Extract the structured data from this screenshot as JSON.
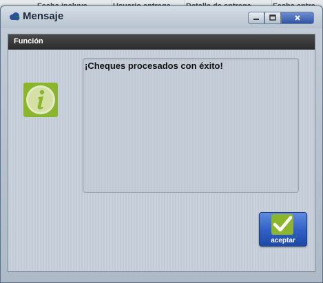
{
  "background": {
    "columns": [
      "Fecha incluye",
      "Usuario entrega",
      "Detalle de entrega",
      "Fecha entre"
    ]
  },
  "window": {
    "title": "Mensaje",
    "title_icon": "cloud-icon",
    "buttons": {
      "minimize": "minimize-icon",
      "maximize": "maximize-icon",
      "close": "close-icon"
    }
  },
  "section": {
    "header": "Función"
  },
  "message": {
    "icon": "info-icon",
    "text": "¡Cheques procesados con éxito!"
  },
  "accept_button": {
    "label": "aceptar",
    "icon": "checkmark-icon"
  },
  "colors": {
    "accent_blue": "#2f5fc4",
    "info_green": "#8bb52a",
    "header_dark": "#3a3a3a"
  }
}
